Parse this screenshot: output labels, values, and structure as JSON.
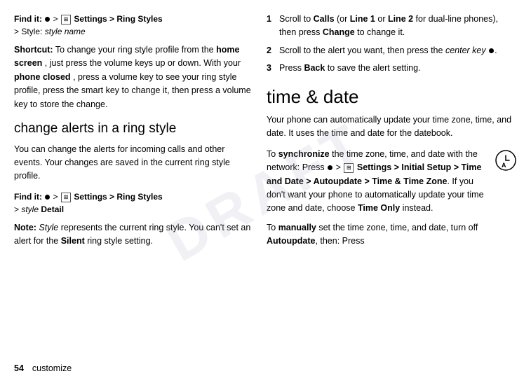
{
  "watermark": "DRAFT",
  "left": {
    "find_it_1": {
      "prefix": "Find it: ",
      "dot": "●",
      "arrow1": " > ",
      "menu": "⊞",
      "settings": " Settings > ",
      "ring": "Ring Styles",
      "line2": "> Style: ",
      "style_italic": "style name"
    },
    "shortcut": {
      "label": "Shortcut:",
      "text": " To change your ring style profile from the ",
      "home_screen": "home screen",
      "text2": ", just press the volume keys up or down. With your ",
      "phone_closed": "phone closed",
      "text3": ", press a volume key to see your ring style profile, press the smart key to change it, then press a volume key to store the change."
    },
    "section_heading": "change alerts in a ring style",
    "body1": "You can change the alerts for incoming calls and other events. Your changes are saved in the current ring style profile.",
    "find_it_2": {
      "prefix": "Find it: ",
      "dot": "●",
      "arrow1": " > ",
      "menu": "⊞",
      "settings": " Settings > ",
      "ring": "Ring Styles",
      "line2": "> ",
      "style_italic": "style",
      "detail": " Detail"
    },
    "note": {
      "label": "Note:",
      "text1": " ",
      "style_italic": "Style",
      "text2": " represents the current ring style. You can't set an alert for the ",
      "silent": "Silent",
      "text3": " ring style setting."
    }
  },
  "right": {
    "steps": [
      {
        "num": "1",
        "text1": "Scroll to ",
        "calls": "Calls",
        "text2": " (or ",
        "line1": "Line 1",
        "text3": " or ",
        "line2": "Line 2",
        "text4": " for dual-line phones), then press ",
        "change": "Change",
        "text5": " to change it."
      },
      {
        "num": "2",
        "text1": "Scroll to the alert you want, then press the ",
        "center_key": "center key",
        "dot": "●",
        "text2": "."
      },
      {
        "num": "3",
        "text1": "Press ",
        "back": "Back",
        "text2": " to save the alert setting."
      }
    ],
    "big_heading": "time & date",
    "body1": "Your phone can automatically update your time zone, time, and date. It uses the time and date for the datebook.",
    "sync_para": {
      "text1": "To ",
      "synchronize": "synchronize",
      "text2": " the time zone, time, and date with the network: Press",
      "dot": "●",
      "arrow1": " > ",
      "menu": "⊞",
      "settings": " Settings > ",
      "initial": "Initial Setup",
      "arrow2": " > ",
      "time_date": "Time and Date",
      "arrow3": " > ",
      "autoupdate": "Autoupdate",
      "arrow4": " > ",
      "time_zone": "Time & Time Zone",
      "text3": ". If you don't want your phone to automatically update your time zone and date, choose ",
      "time_only": "Time Only",
      "text4": " instead."
    },
    "manual_para": {
      "text1": "To ",
      "manually": "manually",
      "text2": " set the time zone, time, and date, turn off ",
      "autoupdate": "Autoupdate",
      "text3": ", then: Press"
    }
  },
  "footer": {
    "page_number": "54",
    "label": "customize"
  }
}
